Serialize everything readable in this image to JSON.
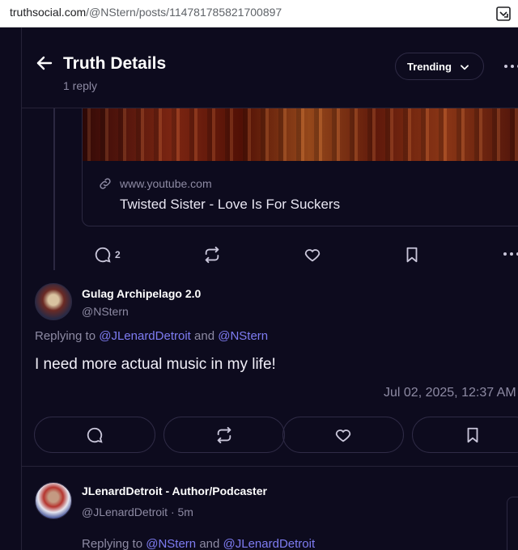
{
  "browser": {
    "url_host": "truthsocial.com",
    "url_path": "/@NStern/posts/114781785821700897"
  },
  "header": {
    "title": "Truth Details",
    "subtitle": "1 reply",
    "sort_label": "Trending"
  },
  "link_card": {
    "domain": "www.youtube.com",
    "title": "Twisted Sister - Love Is For Suckers"
  },
  "original_actions": {
    "reply_count": "2"
  },
  "reply": {
    "display_name": "Gulag Archipelago 2.0",
    "handle": "@NStern",
    "replying_prefix": "Replying to",
    "mention_1": "@JLenardDetroit",
    "and_word": "and",
    "mention_2": "@NStern",
    "text": "I need more actual music in my life!",
    "timestamp": "Jul 02, 2025, 12:37 AM"
  },
  "next_reply": {
    "display_name": "JLenardDetroit - Author/Podcaster",
    "handle": "@JLenardDetroit",
    "time_sep": "·",
    "time": "5m",
    "replying_prefix": "Replying to",
    "mention_1": "@NStern",
    "and_word": "and",
    "mention_2": "@JLenardDetroit"
  },
  "colors": {
    "background": "#0d0b1e",
    "mention": "#7e7cf2",
    "muted": "#8d8aa3",
    "border": "#2f2b46"
  }
}
